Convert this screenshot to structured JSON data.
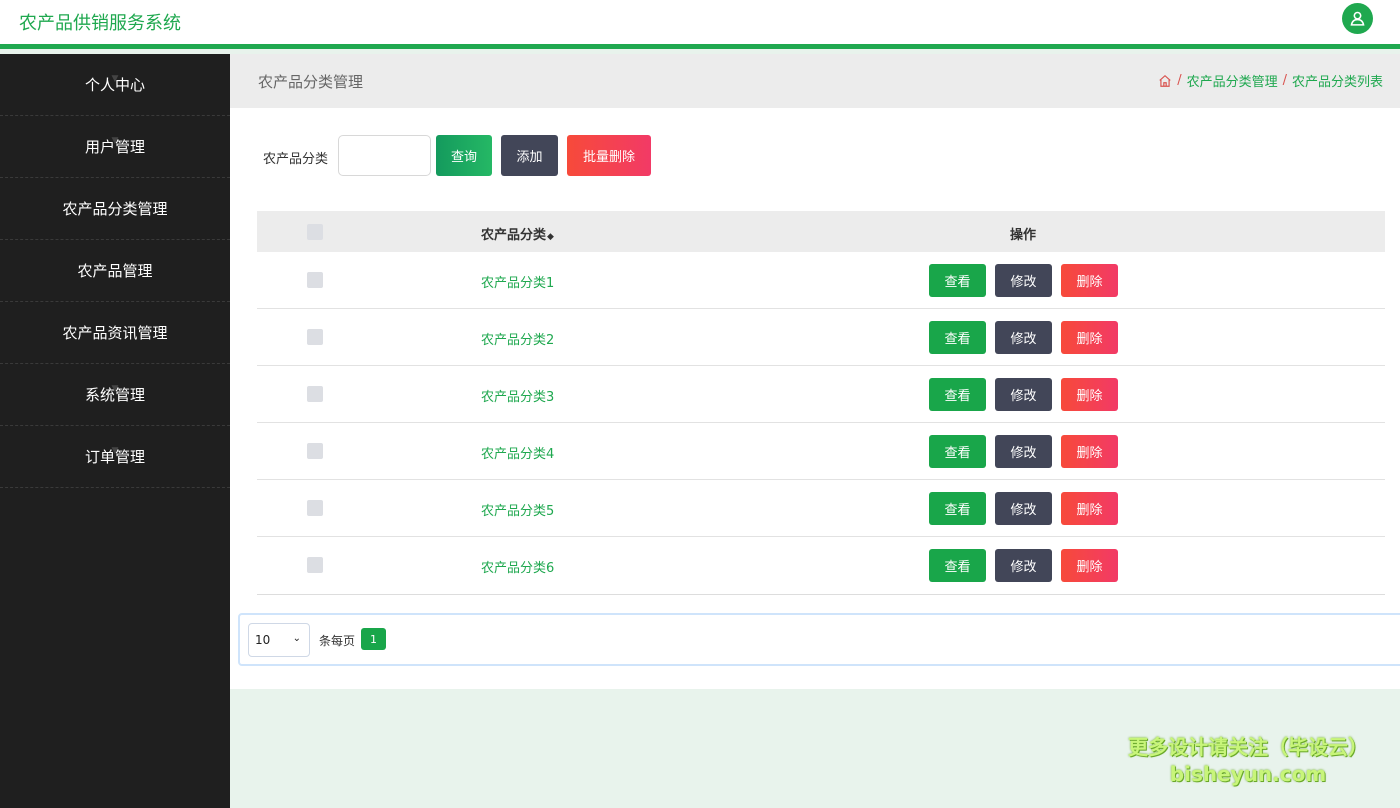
{
  "app": {
    "title": "农产品供销服务系统"
  },
  "sidebar": {
    "items": [
      {
        "label": "个人中心",
        "has_caret": true
      },
      {
        "label": "用户管理",
        "has_caret": true
      },
      {
        "label": "农产品分类管理",
        "has_caret": false
      },
      {
        "label": "农产品管理",
        "has_caret": false
      },
      {
        "label": "农产品资讯管理",
        "has_caret": false
      },
      {
        "label": "系统管理",
        "has_caret": true
      },
      {
        "label": "订单管理",
        "has_caret": true
      }
    ]
  },
  "header": {
    "page_title": "农产品分类管理",
    "breadcrumb": [
      "农产品分类管理",
      "农产品分类列表"
    ]
  },
  "search": {
    "label": "农产品分类",
    "value": "",
    "query_label": "查询",
    "add_label": "添加",
    "batch_delete_label": "批量删除"
  },
  "table": {
    "headers": {
      "name": "农产品分类",
      "ops": "操作"
    },
    "rows": [
      {
        "name": "农产品分类1"
      },
      {
        "name": "农产品分类2"
      },
      {
        "name": "农产品分类3"
      },
      {
        "name": "农产品分类4"
      },
      {
        "name": "农产品分类5"
      },
      {
        "name": "农产品分类6"
      }
    ],
    "actions": {
      "view": "查看",
      "edit": "修改",
      "delete": "删除"
    }
  },
  "pagination": {
    "page_size": "10",
    "per_page_label": "条每页",
    "current_page": "1"
  },
  "watermark": {
    "line1": "更多设计请关注（毕设云）",
    "line2": "bisheyun.com"
  },
  "colors": {
    "primary": "#1fa84f",
    "sidebar_bg": "#1f1f1f",
    "danger": "#f4433c",
    "dark_button": "#424658"
  }
}
